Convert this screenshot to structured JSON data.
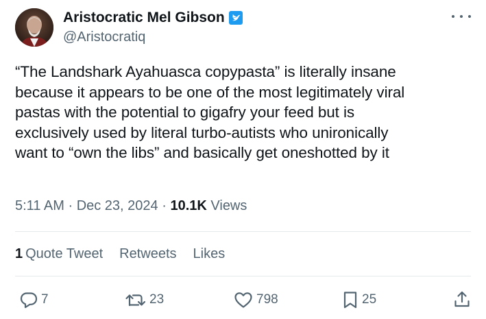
{
  "author": {
    "display_name": "Aristocratic Mel Gibson",
    "handle": "@Aristocratiq",
    "verified": true
  },
  "tweet": {
    "lines": [
      "“The Landshark Ayahuasca copypasta” is literally insane",
      "because it appears to be one of the most legitimately viral",
      "pastas with the potential to gigafry your feed but is",
      "exclusively used by literal turbo-autists who unironically",
      "want to “own the libs” and basically get oneshotted by it"
    ],
    "time": "5:11 AM",
    "date": "Dec 23, 2024",
    "views_count": "10.1K",
    "views_label": "Views"
  },
  "stats": {
    "quote_count": "1",
    "quote_label": "Quote Tweet",
    "retweets_label": "Retweets",
    "likes_label": "Likes"
  },
  "actions": {
    "reply_count": "7",
    "retweet_count": "23",
    "like_count": "798",
    "bookmark_count": "25"
  },
  "colors": {
    "text": "#0f1419",
    "secondary": "#536471",
    "verified": "#1d9bf0",
    "divider": "#e6e9eb"
  }
}
